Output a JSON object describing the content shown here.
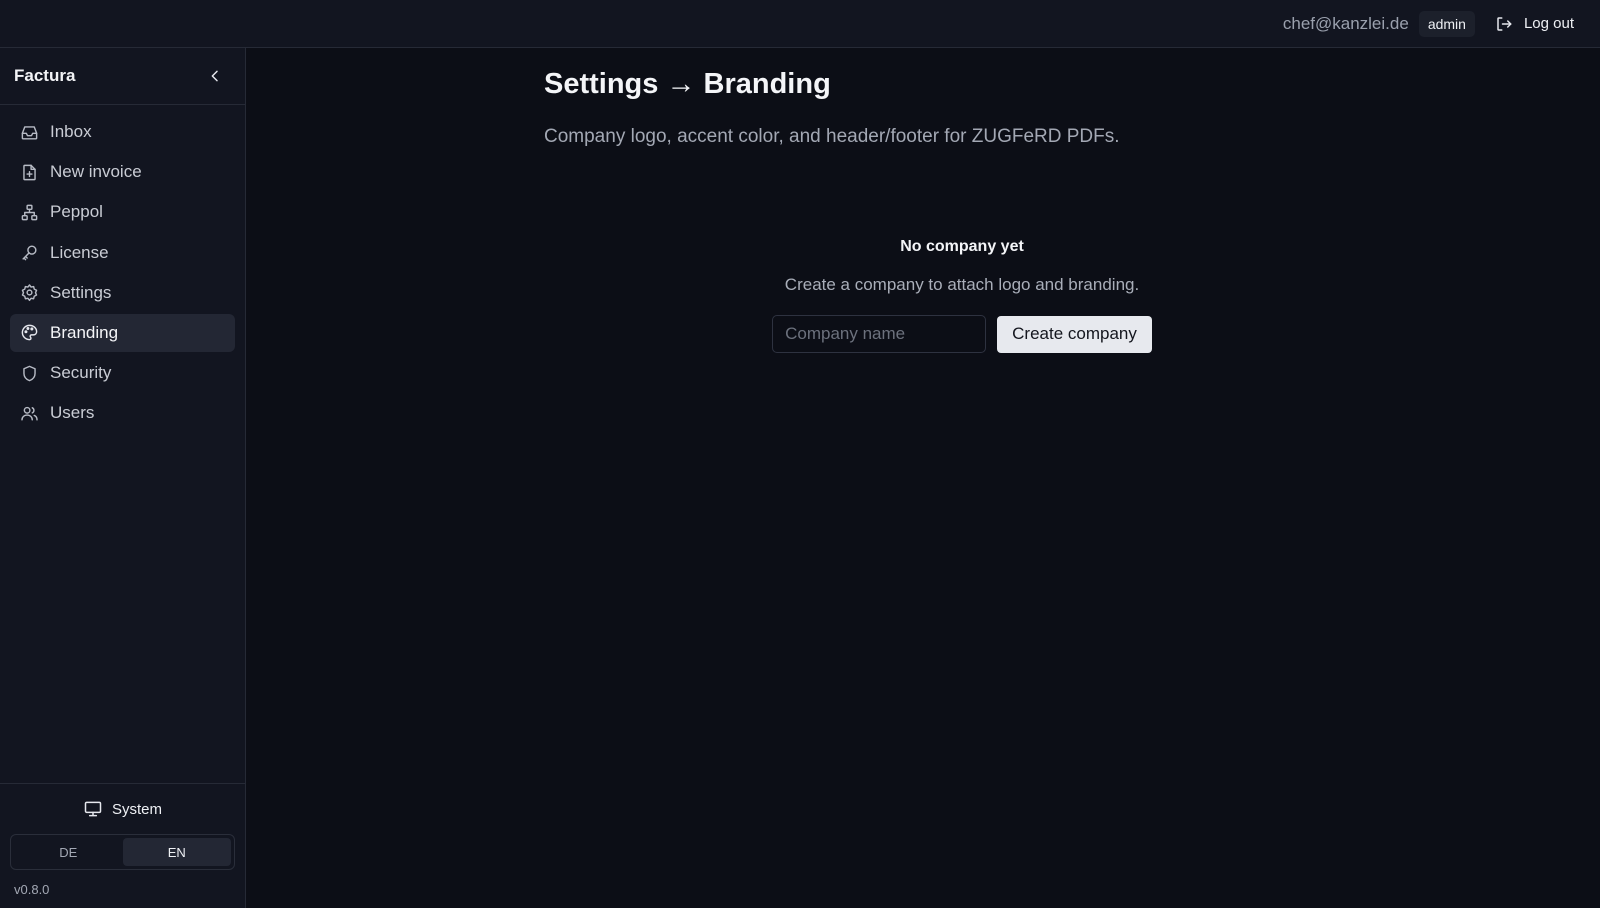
{
  "header": {
    "user_email": "chef@kanzlei.de",
    "role_badge": "admin",
    "logout_label": "Log out",
    "logout_icon": "log-out-icon"
  },
  "sidebar": {
    "brand": "Factura",
    "collapse_icon": "chevron-left-icon",
    "items": [
      {
        "label": "Inbox",
        "icon": "inbox-icon",
        "active": false
      },
      {
        "label": "New invoice",
        "icon": "file-plus-icon",
        "active": false
      },
      {
        "label": "Peppol",
        "icon": "network-icon",
        "active": false
      },
      {
        "label": "License",
        "icon": "key-icon",
        "active": false
      },
      {
        "label": "Settings",
        "icon": "gear-icon",
        "active": false
      },
      {
        "label": "Branding",
        "icon": "palette-icon",
        "active": true
      },
      {
        "label": "Security",
        "icon": "shield-icon",
        "active": false
      },
      {
        "label": "Users",
        "icon": "users-icon",
        "active": false
      }
    ],
    "theme": {
      "label": "System",
      "icon": "monitor-icon"
    },
    "languages": [
      {
        "label": "DE",
        "active": false
      },
      {
        "label": "EN",
        "active": true
      }
    ],
    "version": "v0.8.0"
  },
  "main": {
    "title": "Settings → Branding",
    "subtitle": "Company logo, accent color, and header/footer for ZUGFeRD PDFs.",
    "empty_state": {
      "title": "No company yet",
      "description": "Create a company to attach logo and branding.",
      "input_placeholder": "Company name",
      "input_value": "",
      "button_label": "Create company"
    }
  },
  "colors": {
    "background": "#0c0e16",
    "panel": "#121520",
    "active_item": "#232734",
    "button_bg": "#e7e9ee"
  }
}
